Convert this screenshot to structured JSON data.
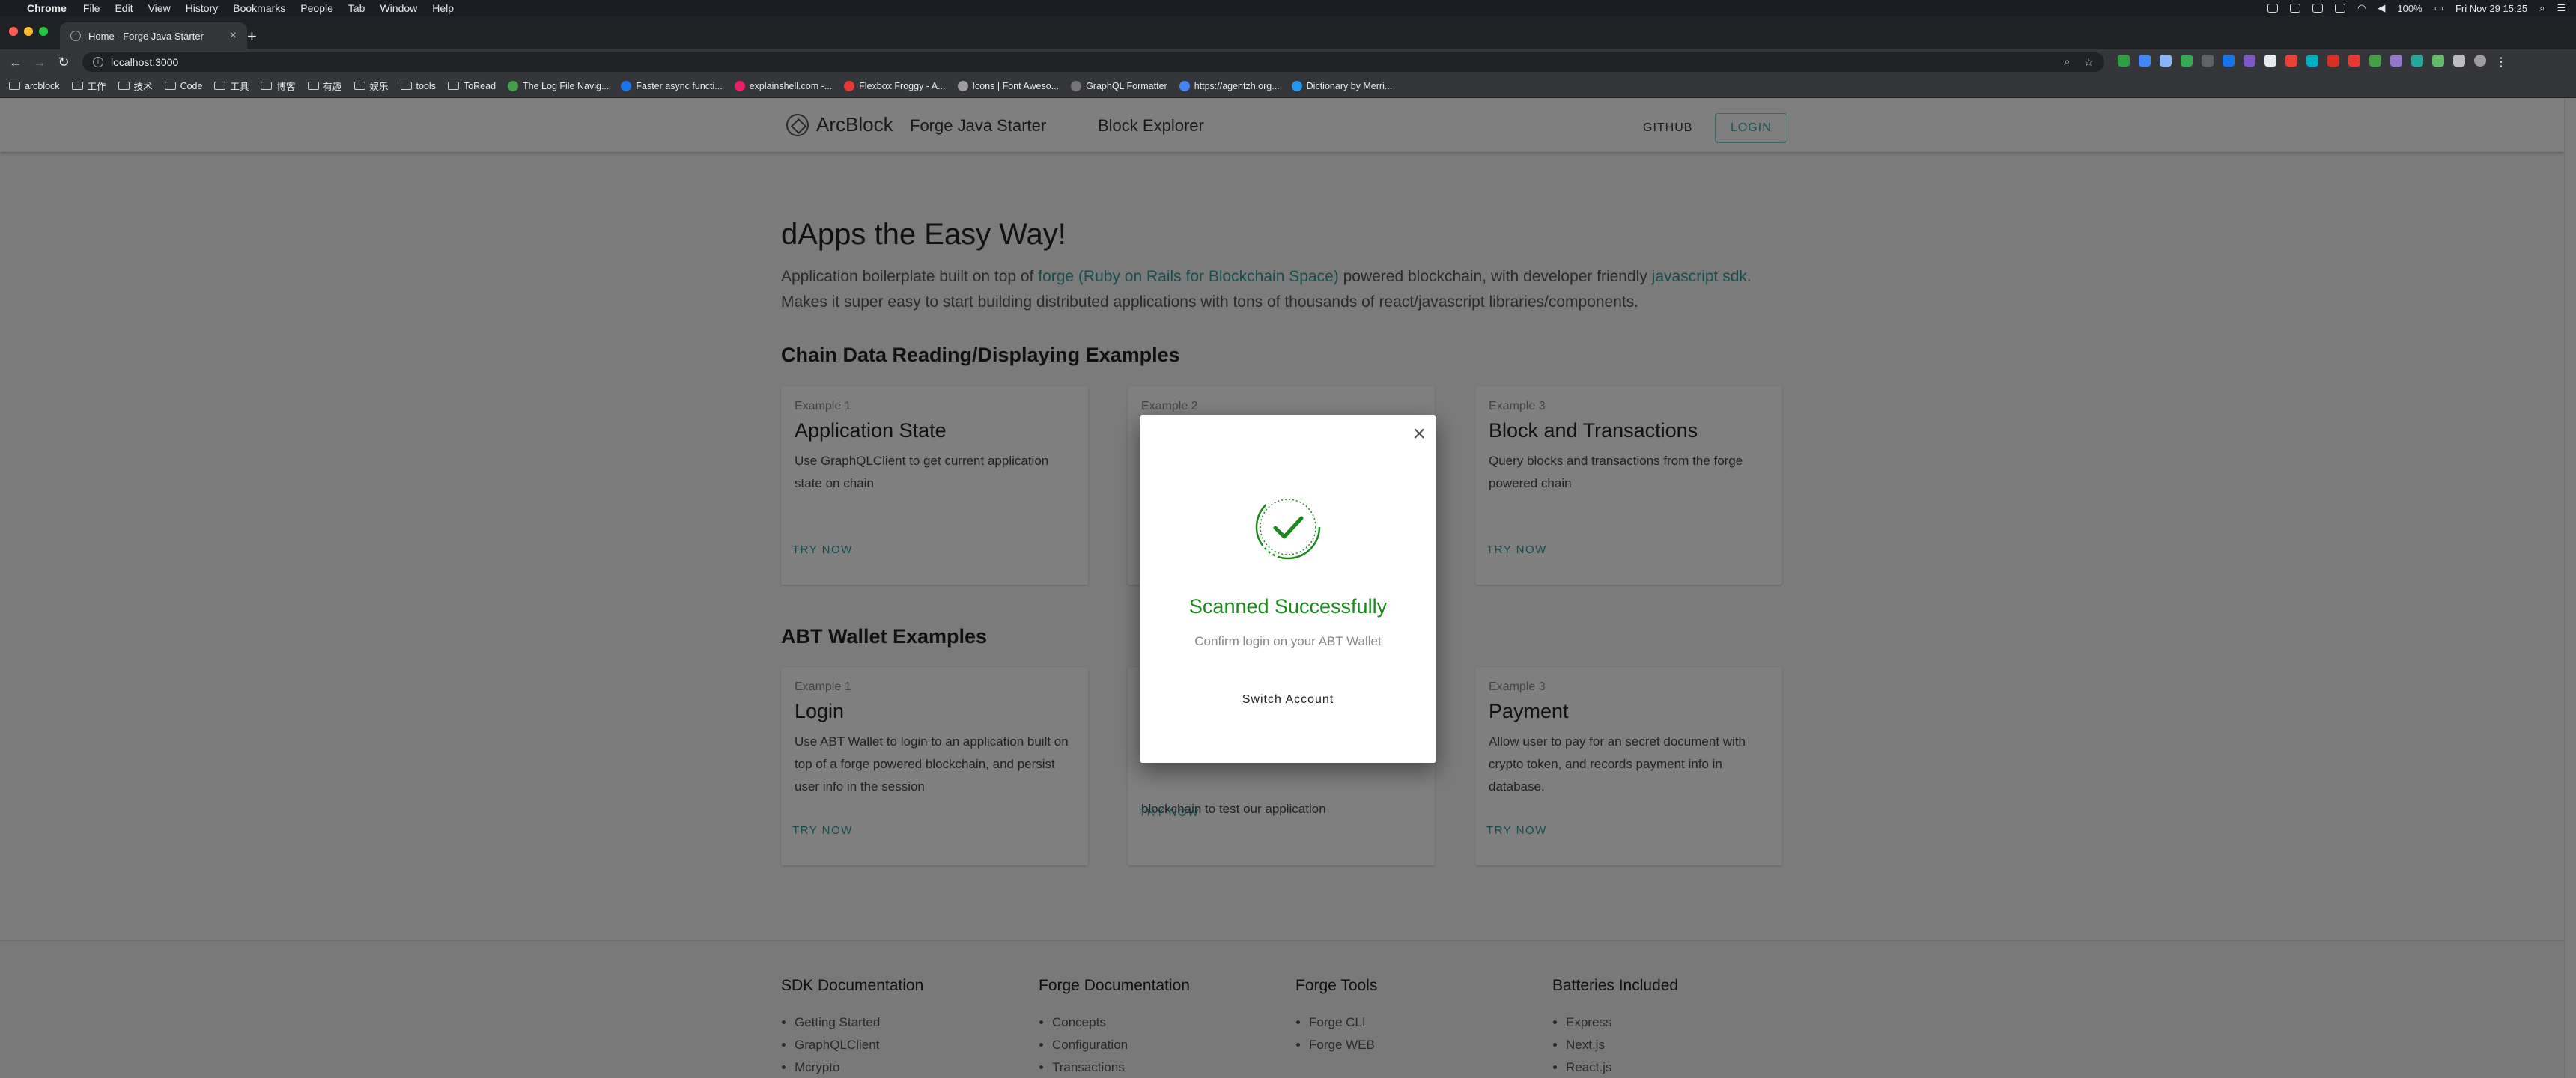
{
  "menubar": {
    "app": "Chrome",
    "items": [
      "File",
      "Edit",
      "View",
      "History",
      "Bookmarks",
      "People",
      "Tab",
      "Window",
      "Help"
    ],
    "battery": "100%",
    "datetime": "Fri Nov 29  15:25"
  },
  "tab": {
    "title": "Home - Forge Java Starter"
  },
  "omnibox": {
    "url": "localhost:3000"
  },
  "bookmarks": [
    {
      "label": "arcblock",
      "type": "folder"
    },
    {
      "label": "工作",
      "type": "folder"
    },
    {
      "label": "技术",
      "type": "folder"
    },
    {
      "label": "Code",
      "type": "folder"
    },
    {
      "label": "工具",
      "type": "folder"
    },
    {
      "label": "博客",
      "type": "folder"
    },
    {
      "label": "有趣",
      "type": "folder"
    },
    {
      "label": "娱乐",
      "type": "folder"
    },
    {
      "label": "tools",
      "type": "folder"
    },
    {
      "label": "ToRead",
      "type": "folder"
    },
    {
      "label": "The Log File Navig...",
      "type": "site"
    },
    {
      "label": "Faster async functi...",
      "type": "site"
    },
    {
      "label": "explainshell.com -...",
      "type": "site"
    },
    {
      "label": "Flexbox Froggy - A...",
      "type": "site"
    },
    {
      "label": "Icons | Font Aweso...",
      "type": "site"
    },
    {
      "label": "GraphQL Formatter",
      "type": "site"
    },
    {
      "label": "https://agentzh.org...",
      "type": "site"
    },
    {
      "label": "Dictionary by Merri...",
      "type": "site"
    }
  ],
  "header": {
    "brand": "ArcBlock",
    "nav": [
      "Forge Java Starter",
      "Block Explorer"
    ],
    "github": "GITHUB",
    "login": "LOGIN"
  },
  "hero": {
    "title": "dApps the Easy Way!",
    "text_1": "Application boilerplate built on top of ",
    "link_1": "forge (Ruby on Rails for Blockchain Space)",
    "text_2": " powered blockchain, with developer friendly ",
    "link_2": "javascript sdk",
    "text_3": ". Makes it super easy to start building distributed applications with tons of thousands of react/javascript libraries/components."
  },
  "sections": [
    {
      "title": "Chain Data Reading/Displaying Examples",
      "cards": [
        {
          "eyebrow": "Example 1",
          "title": "Application State",
          "desc": "Use GraphQLClient to get current application state on chain",
          "cta": "TRY NOW"
        },
        {
          "eyebrow": "Example 2",
          "title": "",
          "desc": "",
          "cta": ""
        },
        {
          "eyebrow": "Example 3",
          "title": "Block and Transactions",
          "desc": "Query blocks and transactions from the forge powered chain",
          "cta": "TRY NOW"
        }
      ]
    },
    {
      "title": "ABT Wallet Examples",
      "cards": [
        {
          "eyebrow": "Example 1",
          "title": "Login",
          "desc": "Use ABT Wallet to login to an application built on top of a forge powered blockchain, and persist user info in the session",
          "cta": "TRY NOW"
        },
        {
          "eyebrow": "",
          "title": "",
          "desc": "blockchain to test our application",
          "cta": "TRY NOW"
        },
        {
          "eyebrow": "Example 3",
          "title": "Payment",
          "desc": "Allow user to pay for an secret document with crypto token, and records payment info in database.",
          "cta": "TRY NOW"
        }
      ]
    }
  ],
  "footer": [
    {
      "heading": "SDK Documentation",
      "links": [
        "Getting Started",
        "GraphQLClient",
        "Mcrypto"
      ]
    },
    {
      "heading": "Forge Documentation",
      "links": [
        "Concepts",
        "Configuration",
        "Transactions"
      ]
    },
    {
      "heading": "Forge Tools",
      "links": [
        "Forge CLI",
        "Forge WEB"
      ]
    },
    {
      "heading": "Batteries Included",
      "links": [
        "Express",
        "Next.js",
        "React.js"
      ]
    }
  ],
  "dialog": {
    "title": "Scanned Successfully",
    "subtitle": "Confirm login on your ABT Wallet",
    "action": "Switch Account",
    "success_color": "#1a8a1a"
  }
}
